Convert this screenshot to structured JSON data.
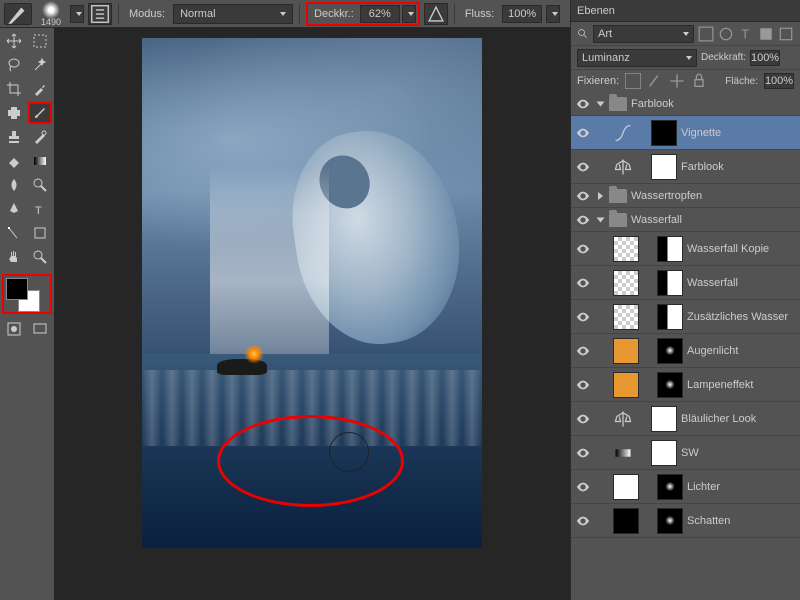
{
  "topbar": {
    "brush_size": "1490",
    "modus_label": "Modus:",
    "modus_value": "Normal",
    "deckkr_label": "Deckkr.:",
    "deckkr_value": "62%",
    "fluss_label": "Fluss:",
    "fluss_value": "100%"
  },
  "panel": {
    "tab": "Ebenen",
    "search_label": "Art",
    "blend_mode": "Luminanz",
    "deckkraft_label": "Deckkraft:",
    "deckkraft_value": "100%",
    "fixieren_label": "Fixieren:",
    "flaeche_label": "Fläche:",
    "flaeche_value": "100%"
  },
  "layers": [
    {
      "type": "group",
      "name": "Farblook",
      "open": true,
      "indent": 0
    },
    {
      "type": "adj",
      "name": "Vignette",
      "indent": 1,
      "selected": true,
      "adj": "curves",
      "mask": "black"
    },
    {
      "type": "adj",
      "name": "Farblook",
      "indent": 1,
      "adj": "balance",
      "mask": "white"
    },
    {
      "type": "group",
      "name": "Wassertropfen",
      "open": false,
      "indent": 0
    },
    {
      "type": "group",
      "name": "Wasserfall",
      "open": true,
      "indent": 0
    },
    {
      "type": "layer",
      "name": "Wasserfall Kopie",
      "indent": 1,
      "thumb": "checker",
      "mask": "mix"
    },
    {
      "type": "layer",
      "name": "Wasserfall",
      "indent": 1,
      "thumb": "checker",
      "mask": "mix"
    },
    {
      "type": "layer",
      "name": "Zusätzliches Wasser",
      "indent": 1,
      "thumb": "checker",
      "mask": "mix"
    },
    {
      "type": "fill",
      "name": "Augenlicht",
      "indent": 1,
      "thumb": "orange",
      "mask": "spot"
    },
    {
      "type": "fill",
      "name": "Lampeneffekt",
      "indent": 1,
      "thumb": "orange",
      "mask": "spot"
    },
    {
      "type": "adj",
      "name": "Bläulicher Look",
      "indent": 1,
      "adj": "balance",
      "mask": "white"
    },
    {
      "type": "adj",
      "name": "SW",
      "indent": 1,
      "adj": "gradient",
      "mask": "white"
    },
    {
      "type": "fill",
      "name": "Lichter",
      "indent": 1,
      "thumb": "white",
      "mask": "spot"
    },
    {
      "type": "fill",
      "name": "Schatten",
      "indent": 1,
      "thumb": "black",
      "mask": "spot"
    }
  ]
}
